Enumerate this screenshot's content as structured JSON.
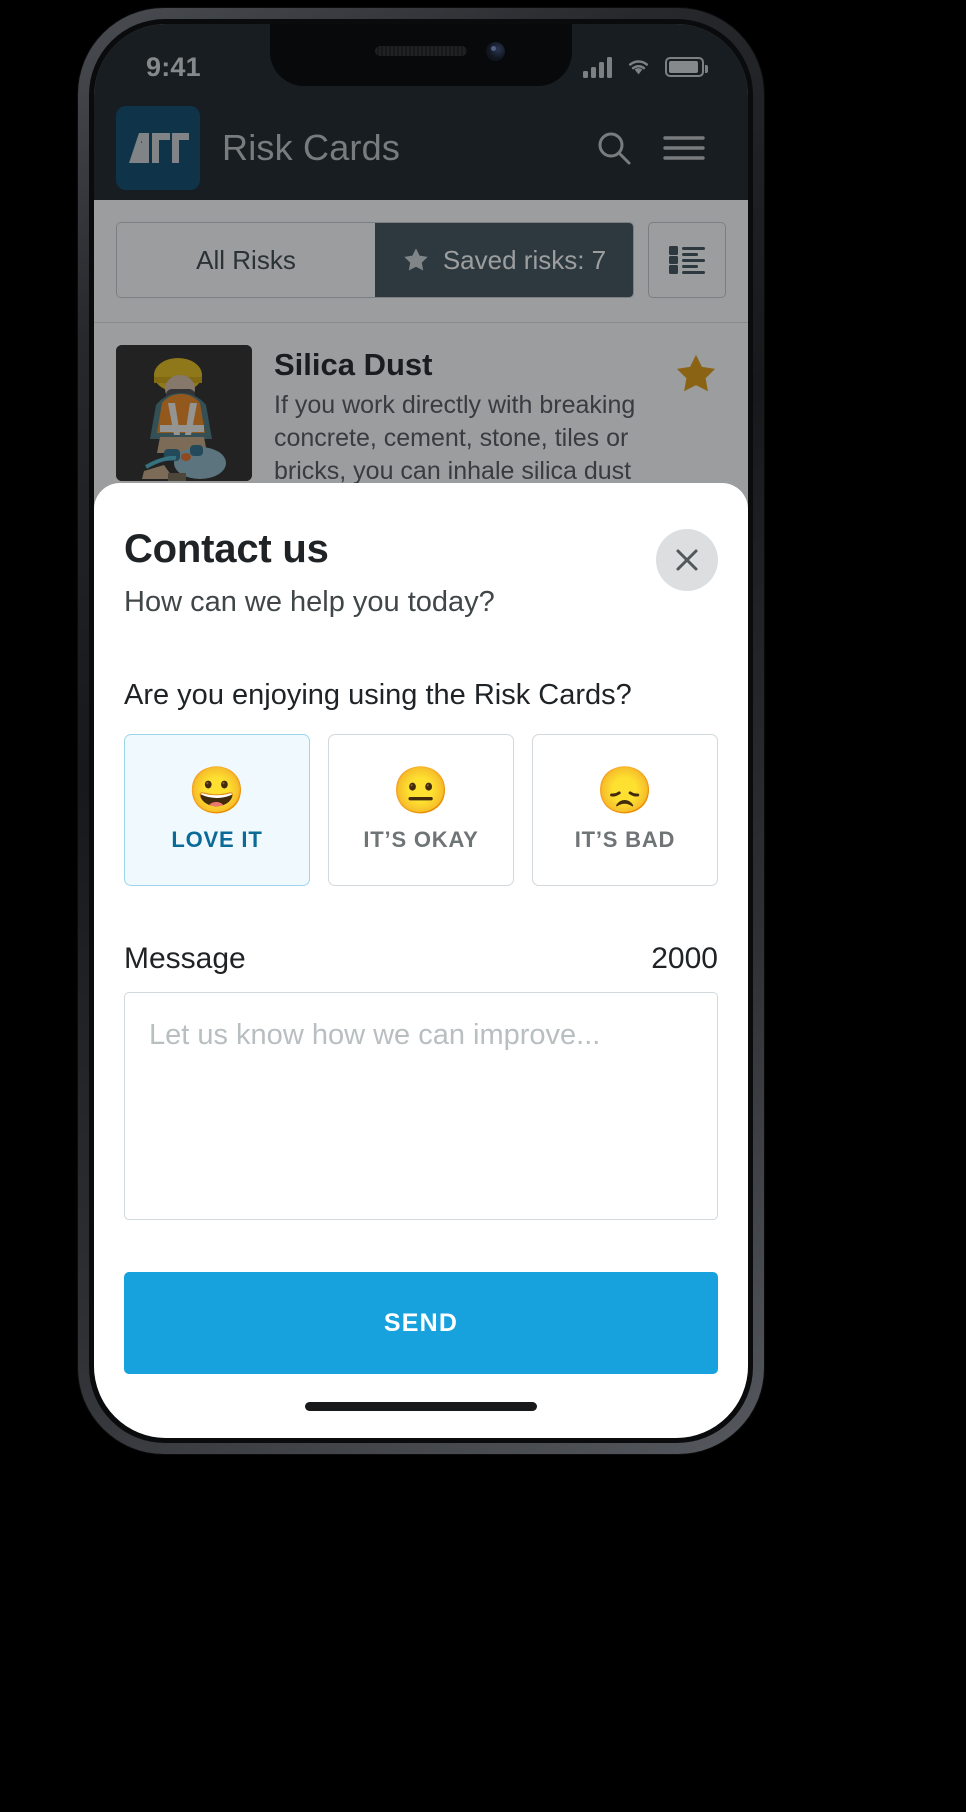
{
  "status_bar": {
    "time": "9:41",
    "signal_icon": "signal-bars-icon",
    "wifi_icon": "wifi-icon",
    "battery_icon": "battery-icon"
  },
  "app_header": {
    "logo_text": "ACC",
    "logo_name": "acc-logo",
    "title": "Risk Cards",
    "search_icon": "search-icon",
    "menu_icon": "hamburger-menu-icon",
    "background": "#1b2429",
    "logo_background": "#0d4a6e"
  },
  "tabs": {
    "all_risks": "All Risks",
    "saved_risks": "Saved risks: 7",
    "saved_star_icon": "star-icon",
    "list_view_icon": "list-view-icon",
    "active_tab": "saved_risks",
    "active_background": "#40535c"
  },
  "risk_list": {
    "items": [
      {
        "title": "Silica Dust",
        "description": "If you work directly with breaking concrete, cement, stone, tiles or bricks, you can inhale silica dust ...",
        "thumbnail": "worker-with-concrete-saw-illustration",
        "saved_icon": "star-filled-icon",
        "saved_color": "#e09b12",
        "drag_handle_icon": "drag-handle-icon"
      }
    ]
  },
  "modal": {
    "title": "Contact us",
    "subtitle": "How can we help you today?",
    "close_icon": "close-icon",
    "question": "Are you enjoying using the Risk Cards?",
    "options": [
      {
        "emoji": "😀",
        "emoji_name": "grinning-face-emoji",
        "label": "LOVE IT",
        "selected": true
      },
      {
        "emoji": "😐",
        "emoji_name": "neutral-face-emoji",
        "label": "IT’S OKAY",
        "selected": false
      },
      {
        "emoji": "😞",
        "emoji_name": "sad-face-emoji",
        "label": "IT’S BAD",
        "selected": false
      }
    ],
    "message_label": "Message",
    "character_count": "2000",
    "message_value": "",
    "message_placeholder": "Let us know how we can improve...",
    "send_label": "SEND",
    "send_color": "#17a2dd",
    "selected_option_background": "#f0f9fd",
    "selected_option_text_color": "#0a6b98"
  },
  "home_indicator": "home-indicator"
}
